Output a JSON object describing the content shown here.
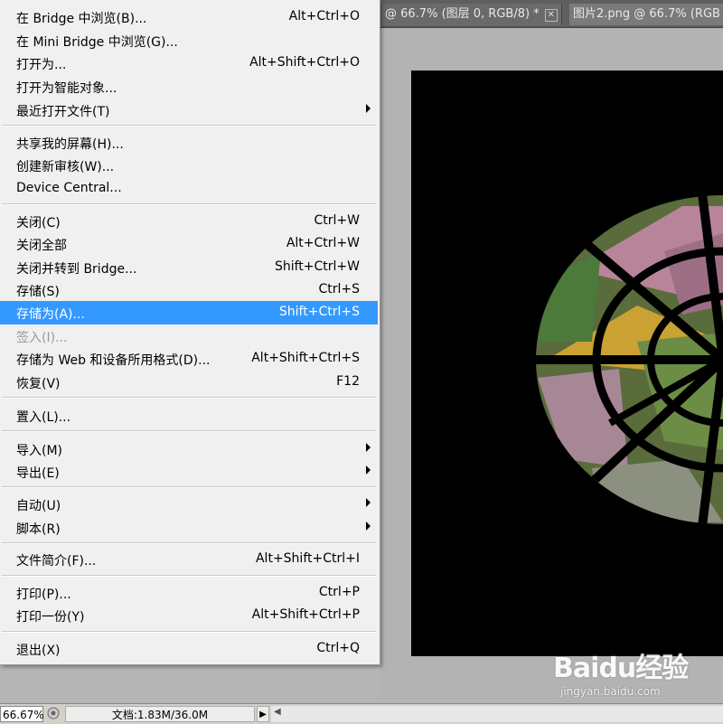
{
  "tabs": {
    "doc1_title": "@ 66.7% (图层 0, RGB/8) *",
    "doc1_close": "✕",
    "doc2_title": "图片2.png @ 66.7% (RGB"
  },
  "menu": {
    "items": [
      {
        "label": "在 Bridge 中浏览(B)...",
        "shortcut": "Alt+Ctrl+O"
      },
      {
        "label": "在 Mini Bridge 中浏览(G)...",
        "shortcut": ""
      },
      {
        "label": "打开为...",
        "shortcut": "Alt+Shift+Ctrl+O"
      },
      {
        "label": "打开为智能对象...",
        "shortcut": ""
      },
      {
        "label": "最近打开文件(T)",
        "shortcut": ""
      },
      {
        "label": "共享我的屏幕(H)...",
        "shortcut": ""
      },
      {
        "label": "创建新审核(W)...",
        "shortcut": ""
      },
      {
        "label": "Device Central...",
        "shortcut": ""
      },
      {
        "label": "关闭(C)",
        "shortcut": "Ctrl+W"
      },
      {
        "label": "关闭全部",
        "shortcut": "Alt+Ctrl+W"
      },
      {
        "label": "关闭并转到 Bridge...",
        "shortcut": "Shift+Ctrl+W"
      },
      {
        "label": "存储(S)",
        "shortcut": "Ctrl+S"
      },
      {
        "label": "存储为(A)...",
        "shortcut": "Shift+Ctrl+S"
      },
      {
        "label": "签入(I)...",
        "shortcut": ""
      },
      {
        "label": "存储为 Web 和设备所用格式(D)...",
        "shortcut": "Alt+Shift+Ctrl+S"
      },
      {
        "label": "恢复(V)",
        "shortcut": "F12"
      },
      {
        "label": "置入(L)...",
        "shortcut": ""
      },
      {
        "label": "导入(M)",
        "shortcut": ""
      },
      {
        "label": "导出(E)",
        "shortcut": ""
      },
      {
        "label": "自动(U)",
        "shortcut": ""
      },
      {
        "label": "脚本(R)",
        "shortcut": ""
      },
      {
        "label": "文件简介(F)...",
        "shortcut": "Alt+Shift+Ctrl+I"
      },
      {
        "label": "打印(P)...",
        "shortcut": "Ctrl+P"
      },
      {
        "label": "打印一份(Y)",
        "shortcut": "Alt+Shift+Ctrl+P"
      },
      {
        "label": "退出(X)",
        "shortcut": "Ctrl+Q"
      }
    ]
  },
  "status": {
    "zoom": "66.67%",
    "doc_info": "文档:1.83M/36.0M",
    "arrow": "▶",
    "scroll_left": "◀"
  },
  "watermark": {
    "brand": "Baidu经验",
    "url": "jingyan.baidu.com"
  },
  "colors": {
    "menu_bg": "#f0f0f0",
    "selected_bg": "#3399ff",
    "disabled_text": "#9a9a9a",
    "canvas_bg": "#000000"
  }
}
